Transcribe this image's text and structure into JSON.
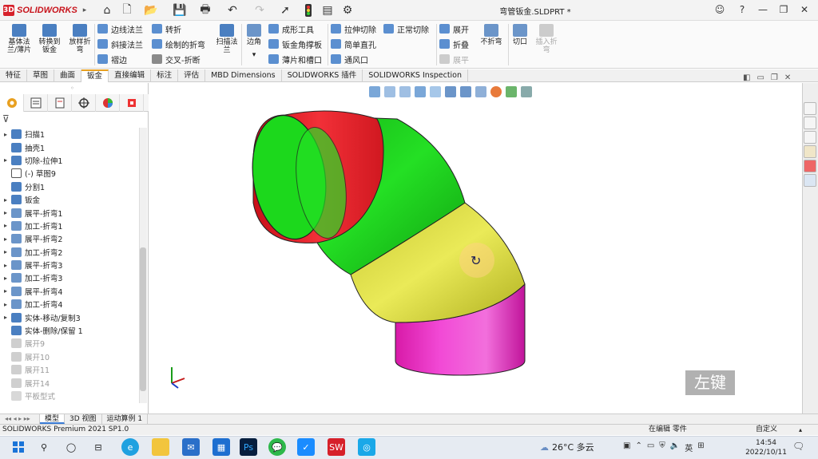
{
  "app": {
    "logo_text": "SOLIDWORKS",
    "logo_mark": "3DS",
    "doc_title": "弯管钣金.SLDPRT *"
  },
  "titlebar_icons": [
    "home-icon",
    "new-doc-icon",
    "open-folder-icon",
    "save-icon",
    "print-icon",
    "undo-icon",
    "redo-icon",
    "select-arrow-icon",
    "traffic-light-icon",
    "file-props-icon",
    "gear-icon"
  ],
  "window_controls": {
    "user": "☺",
    "help": "?",
    "minimize": "—",
    "restore": "❐",
    "close": "✕"
  },
  "ribbon": {
    "big": [
      {
        "label": "基体法\n兰/薄片",
        "icon": "base-flange-icon",
        "color": "#4a7fc1"
      },
      {
        "label": "转换到\n钣金",
        "icon": "convert-sheetmetal-icon",
        "color": "#4a7fc1"
      },
      {
        "label": "放样折\n弯",
        "icon": "lofted-bend-icon",
        "color": "#4a7fc1"
      }
    ],
    "col1": [
      "边线法兰",
      "斜接法兰",
      "褶边"
    ],
    "col2": [
      "转折",
      "绘制的折弯",
      "交叉-折断"
    ],
    "sweep": "扫描法\n兰",
    "corner": "边角",
    "col3": [
      "成形工具",
      "钣金角撑板",
      "薄片和槽口"
    ],
    "col4": [
      "拉伸切除",
      "简单直孔",
      "通风口"
    ],
    "normal_cut": "正常切除",
    "col5": [
      "展开",
      "折叠",
      "展平"
    ],
    "unbend": "不折弯",
    "cut": "切口",
    "rip": "插入折\n弯"
  },
  "tabs": [
    "特征",
    "草图",
    "曲面",
    "钣金",
    "直接编辑",
    "标注",
    "评估",
    "MBD Dimensions",
    "SOLIDWORKS 插件",
    "SOLIDWORKS Inspection"
  ],
  "active_tab": "钣金",
  "tree": [
    {
      "label": "扫描1",
      "icon": "sweep-icon",
      "exp": "▸",
      "dim": false
    },
    {
      "label": "抽壳1",
      "icon": "shell-icon",
      "exp": "",
      "dim": false
    },
    {
      "label": "切除-拉伸1",
      "icon": "cut-extrude-icon",
      "exp": "▸",
      "dim": false
    },
    {
      "label": "(-) 草图9",
      "icon": "sketch-icon",
      "exp": "",
      "dim": false
    },
    {
      "label": "分割1",
      "icon": "split-icon",
      "exp": "",
      "dim": false
    },
    {
      "label": "钣金",
      "icon": "sheetmetal-icon",
      "exp": "▸",
      "dim": false
    },
    {
      "label": "展平-折弯1",
      "icon": "flatten-bend-icon",
      "exp": "▸",
      "dim": false
    },
    {
      "label": "加工-折弯1",
      "icon": "process-bend-icon",
      "exp": "▸",
      "dim": false
    },
    {
      "label": "展平-折弯2",
      "icon": "flatten-bend-icon",
      "exp": "▸",
      "dim": false
    },
    {
      "label": "加工-折弯2",
      "icon": "process-bend-icon",
      "exp": "▸",
      "dim": false
    },
    {
      "label": "展平-折弯3",
      "icon": "flatten-bend-icon",
      "exp": "▸",
      "dim": false
    },
    {
      "label": "加工-折弯3",
      "icon": "process-bend-icon",
      "exp": "▸",
      "dim": false
    },
    {
      "label": "展平-折弯4",
      "icon": "flatten-bend-icon",
      "exp": "▸",
      "dim": false
    },
    {
      "label": "加工-折弯4",
      "icon": "process-bend-icon",
      "exp": "▸",
      "dim": false
    },
    {
      "label": "实体-移动/复制3",
      "icon": "move-body-icon",
      "exp": "▸",
      "dim": false
    },
    {
      "label": "实体-删除/保留 1",
      "icon": "delete-body-icon",
      "exp": "",
      "dim": false
    },
    {
      "label": "展开9",
      "icon": "unfold-icon",
      "exp": "",
      "dim": true
    },
    {
      "label": "展开10",
      "icon": "unfold-icon",
      "exp": "",
      "dim": true
    },
    {
      "label": "展开11",
      "icon": "unfold-icon",
      "exp": "",
      "dim": true
    },
    {
      "label": "展开14",
      "icon": "unfold-icon",
      "exp": "",
      "dim": true
    },
    {
      "label": "平板型式",
      "icon": "flat-pattern-icon",
      "exp": "",
      "dim": true
    }
  ],
  "model_tabs": [
    "模型",
    "3D 视图",
    "运动算例 1"
  ],
  "status": {
    "left": "SOLIDWORKS Premium 2021 SP1.0",
    "mid": "在编辑 零件",
    "units": "自定义"
  },
  "watermark": "左键",
  "taskbar": {
    "temp": "26°C 多云",
    "ime": "英",
    "time": "14:54",
    "date": "2022/10/11"
  },
  "colors": {
    "red": "#e8202a",
    "green": "#1fd81f",
    "yellow": "#e6e64c",
    "magenta": "#ee2ecc"
  }
}
